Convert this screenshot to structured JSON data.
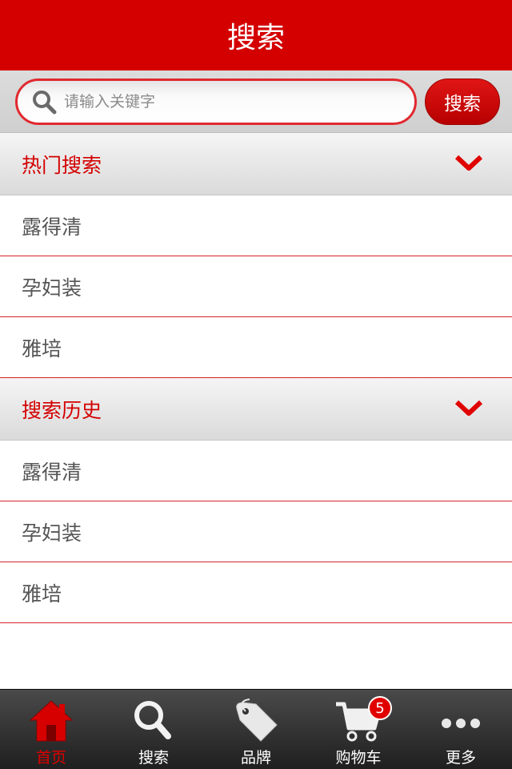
{
  "header": {
    "title": "搜索"
  },
  "search": {
    "placeholder": "请输入关键字",
    "value": "",
    "button_label": "搜索"
  },
  "hot_search": {
    "title": "热门搜索",
    "items": [
      {
        "label": "露得清"
      },
      {
        "label": "孕妇装"
      },
      {
        "label": "雅培"
      }
    ]
  },
  "history": {
    "title": "搜索历史",
    "items": [
      {
        "label": "露得清"
      },
      {
        "label": "孕妇装"
      },
      {
        "label": "雅培"
      }
    ]
  },
  "tabbar": {
    "tabs": [
      {
        "label": "首页",
        "icon": "home-icon",
        "active": true
      },
      {
        "label": "搜索",
        "icon": "search-icon",
        "active": false
      },
      {
        "label": "品牌",
        "icon": "tag-icon",
        "active": false
      },
      {
        "label": "购物车",
        "icon": "cart-icon",
        "active": false,
        "badge": "5"
      },
      {
        "label": "更多",
        "icon": "more-icon",
        "active": false
      }
    ]
  },
  "colors": {
    "brand": "#d40000",
    "text": "#555555",
    "divider": "#d4232a"
  }
}
